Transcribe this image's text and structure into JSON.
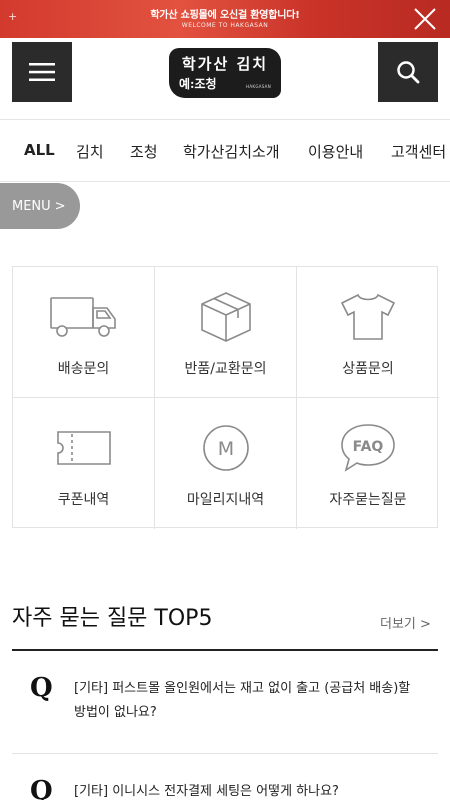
{
  "promo": {
    "line1": "학가산 쇼핑몰에 오신걸 환영합니다!",
    "line2": "WELCOME TO HAKGASAN",
    "plus": "+"
  },
  "logo": {
    "line1": "학가산 김치",
    "line2": "예:조청",
    "line3": "HAKGASAN"
  },
  "categories": [
    "ALL",
    "김치",
    "조청",
    "학가산김치소개",
    "이용안내",
    "고객센터"
  ],
  "menu_pill": {
    "label": "MENU",
    "chevron": ">"
  },
  "grid": [
    {
      "label": "배송문의",
      "icon": "truck-icon"
    },
    {
      "label": "반품/교환문의",
      "icon": "box-icon"
    },
    {
      "label": "상품문의",
      "icon": "tshirt-icon"
    },
    {
      "label": "쿠폰내역",
      "icon": "coupon-icon"
    },
    {
      "label": "마일리지내역",
      "icon": "mileage-icon"
    },
    {
      "label": "자주묻는질문",
      "icon": "faq-icon"
    }
  ],
  "mileage_letter": "M",
  "faq_badge": "FAQ",
  "faq": {
    "title": "자주 묻는 질문 TOP5",
    "more": "더보기",
    "more_chevron": ">",
    "q_mark": "Q",
    "items": [
      {
        "text": "[기타] 퍼스트몰 올인원에서는 재고 없이 출고 (공급처 배송)할 방법이 없나요?"
      },
      {
        "text": "[기타] 이니시스 전자결제 세팅은 어떻게 하나요?"
      }
    ]
  },
  "colors": {
    "promo_red": "#d23a2e",
    "dark": "#2b2b2b",
    "pill_gray": "#999999"
  }
}
